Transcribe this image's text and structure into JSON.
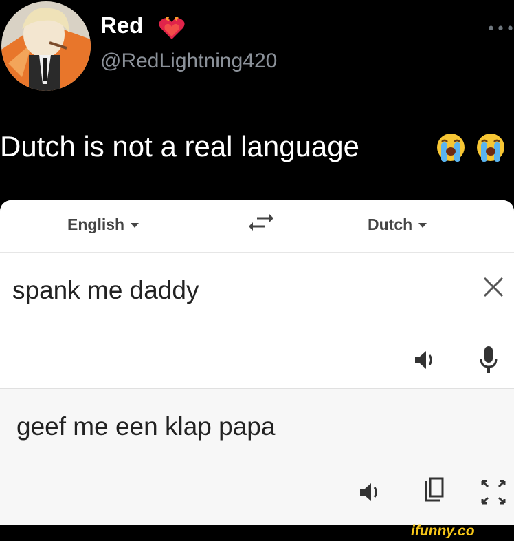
{
  "tweet": {
    "display_name": "Red",
    "handle": "@RedLightning420",
    "text": "Dutch is not a real language",
    "more_icon": "more-dots-icon",
    "emoji": [
      "loudly-crying-face",
      "loudly-crying-face"
    ],
    "name_emoji": "burning-heart"
  },
  "translate": {
    "source_language": "English",
    "target_language": "Dutch",
    "source_text": "spank me daddy",
    "translated_text": "geef me een klap papa",
    "icons": [
      "swap-languages-icon",
      "clear-x-icon",
      "speaker-icon",
      "microphone-icon",
      "copy-icon",
      "fullscreen-icon"
    ]
  },
  "watermark": "ifunny.co",
  "colors": {
    "background": "#000000",
    "handle": "#8b9199",
    "result_pane": "#f7f7f7",
    "watermark": "#f5c518"
  }
}
